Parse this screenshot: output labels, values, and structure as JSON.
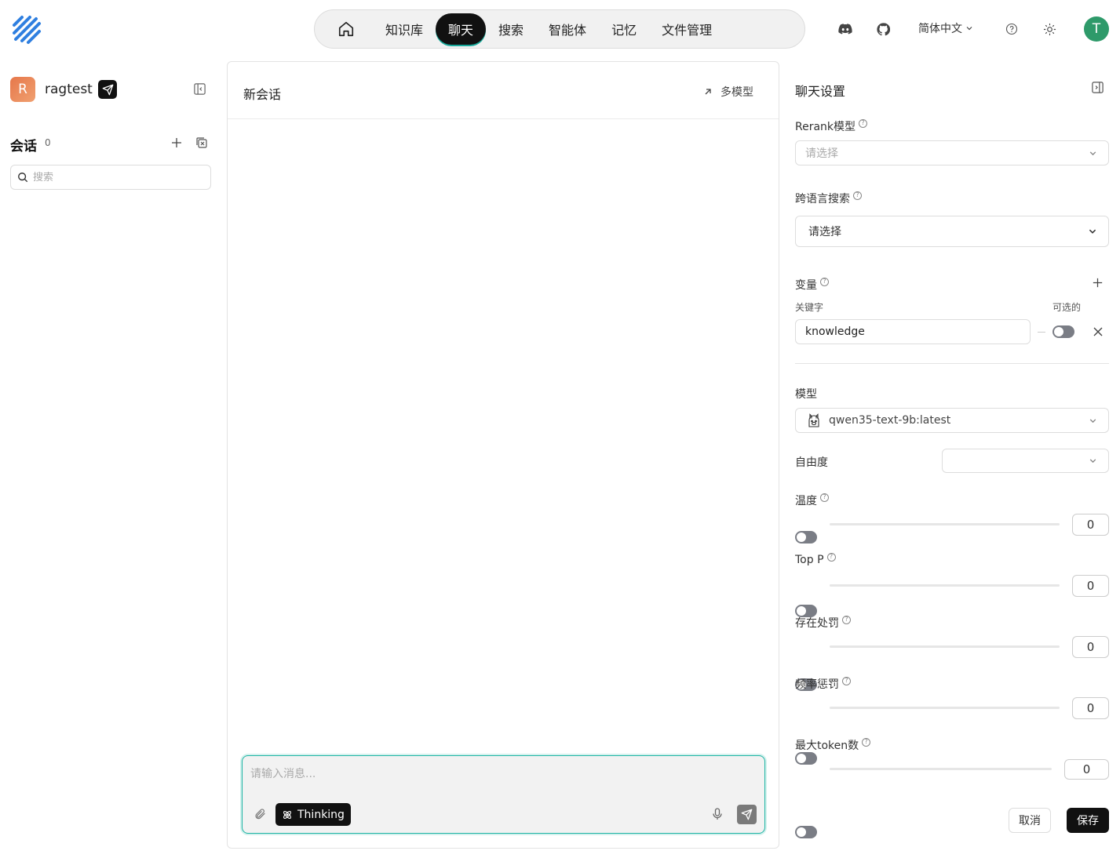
{
  "nav": {
    "items": [
      {
        "label": "知识库"
      },
      {
        "label": "聊天",
        "active": true
      },
      {
        "label": "搜索"
      },
      {
        "label": "智能体"
      },
      {
        "label": "记忆"
      },
      {
        "label": "文件管理"
      }
    ],
    "accent_color": "#17a99a"
  },
  "topbar": {
    "language": "简体中文",
    "user_initial": "T"
  },
  "sidebar": {
    "app_initial": "R",
    "app_name": "ragtest",
    "conversations_title": "会话",
    "conversations_count": "0",
    "search_placeholder": "搜索"
  },
  "chat": {
    "title": "新会话",
    "multi_model_label": "多模型",
    "input_placeholder": "请输入消息...",
    "thinking_label": "Thinking"
  },
  "settings": {
    "title": "聊天设置",
    "rerank_label": "Rerank模型",
    "rerank_placeholder": "请选择",
    "cross_lang_label": "跨语言搜索",
    "cross_lang_value": "请选择",
    "variables_label": "变量",
    "keyword_col": "关键字",
    "optional_col": "可选的",
    "variable_key": "knowledge",
    "model_label": "模型",
    "model_value": "qwen35-text-9b:latest",
    "freedom_label": "自由度",
    "params": [
      {
        "label": "温度",
        "value": "0"
      },
      {
        "label": "Top P",
        "value": "0"
      },
      {
        "label": "存在处罚",
        "value": "0"
      },
      {
        "label": "频率惩罚",
        "value": "0"
      },
      {
        "label": "最大token数",
        "value": "0"
      }
    ],
    "cancel_label": "取消",
    "save_label": "保存"
  }
}
